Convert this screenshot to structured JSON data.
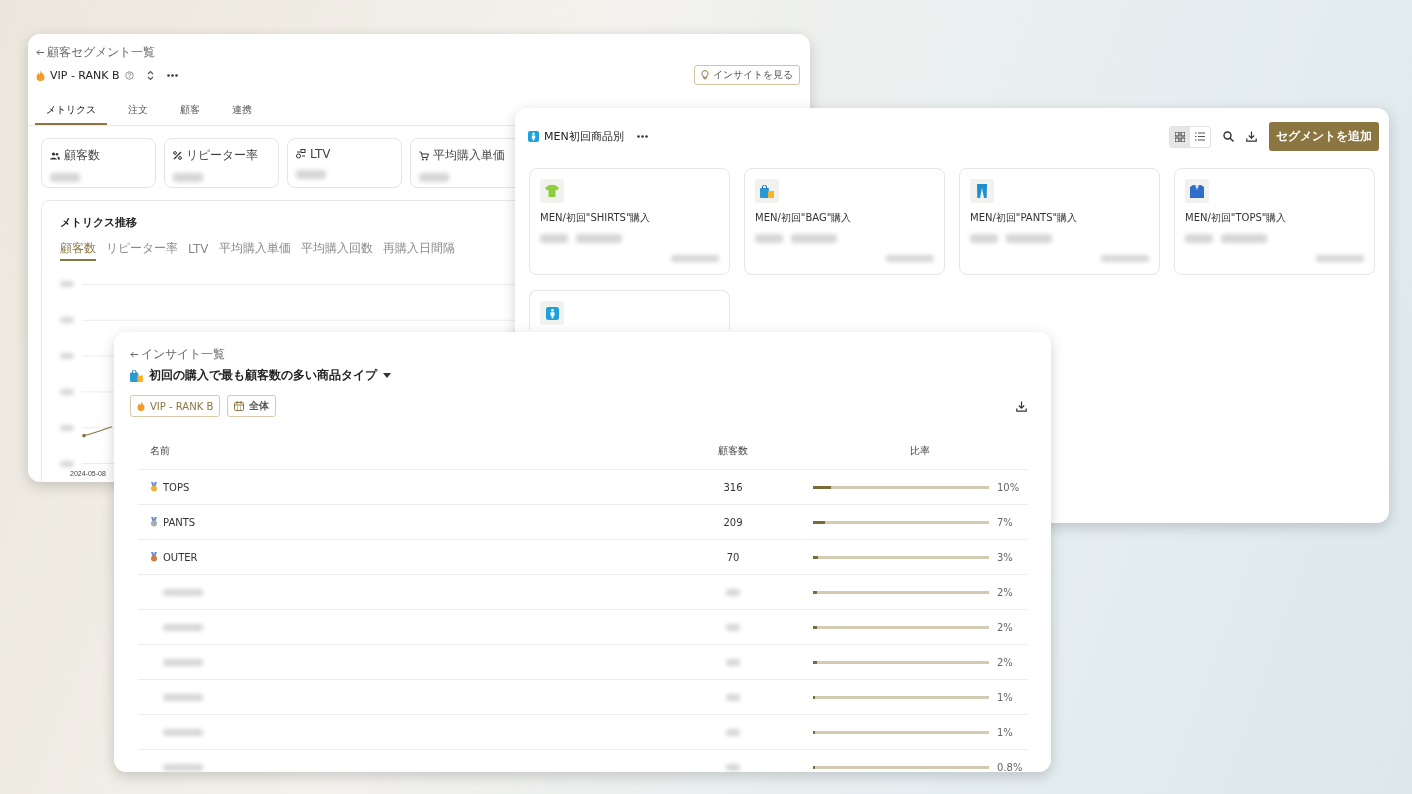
{
  "segment_window": {
    "back_link": "顧客セグメント一覧",
    "title": "VIP - RANK B",
    "insight_button": "インサイトを見る",
    "tabs": [
      {
        "label": "メトリクス",
        "selected": true
      },
      {
        "label": "注文",
        "selected": false
      },
      {
        "label": "顧客",
        "selected": false
      },
      {
        "label": "連携",
        "selected": false
      }
    ],
    "metrics": [
      {
        "kind": "count",
        "label": "顧客数"
      },
      {
        "kind": "rate",
        "label": "リピーター率"
      },
      {
        "kind": "ltv",
        "label": "LTV"
      },
      {
        "kind": "price",
        "label": "平均購入単価"
      }
    ],
    "trend": {
      "title": "メトリクス推移",
      "tabs": [
        {
          "label": "顧客数",
          "selected": true
        },
        {
          "label": "リピーター率",
          "selected": false
        },
        {
          "label": "LTV",
          "selected": false
        },
        {
          "label": "平均購入単価",
          "selected": false
        },
        {
          "label": "平均購入回数",
          "selected": false
        },
        {
          "label": "再購入日間隔",
          "selected": false
        }
      ],
      "x_label": "2024-05-08"
    }
  },
  "group_window": {
    "title": "MEN初回商品別",
    "add_button": "セグメントを追加",
    "views": [
      {
        "kind": "grid",
        "selected": true
      },
      {
        "kind": "list",
        "selected": false
      }
    ],
    "segments": [
      {
        "kind": "shirts",
        "title": "MEN/初回\"SHIRTS\"購入"
      },
      {
        "kind": "bag",
        "title": "MEN/初回\"BAG\"購入"
      },
      {
        "kind": "pants",
        "title": "MEN/初回\"PANTS\"購入"
      },
      {
        "kind": "tops",
        "title": "MEN/初回\"TOPS\"購入"
      },
      {
        "kind": "all"
      }
    ]
  },
  "insight_window": {
    "back_link": "インサイト一覧",
    "title": "初回の購入で最も顧客数の多い商品タイプ",
    "chips": [
      {
        "kind": "segment",
        "label": "VIP - RANK B"
      },
      {
        "kind": "period",
        "label": "全体"
      }
    ],
    "columns": [
      "名前",
      "顧客数",
      "比率"
    ],
    "rows": [
      {
        "color": "#e8b53a",
        "name": "TOPS",
        "count": "316",
        "level": 0.1,
        "share": "10%"
      },
      {
        "color": "#a9adb3",
        "name": "PANTS",
        "count": "209",
        "level": 0.07,
        "share": "7%"
      },
      {
        "color": "#cd7f45",
        "name": "OUTER",
        "count": "70",
        "level": 0.03,
        "share": "3%"
      },
      {
        "level": 0.02,
        "share": "2%"
      },
      {
        "level": 0.02,
        "share": "2%"
      },
      {
        "level": 0.02,
        "share": "2%"
      },
      {
        "level": 0.01,
        "share": "1%"
      },
      {
        "level": 0.01,
        "share": "1%"
      },
      {
        "level": 0.008,
        "share": "0.8%"
      }
    ]
  }
}
